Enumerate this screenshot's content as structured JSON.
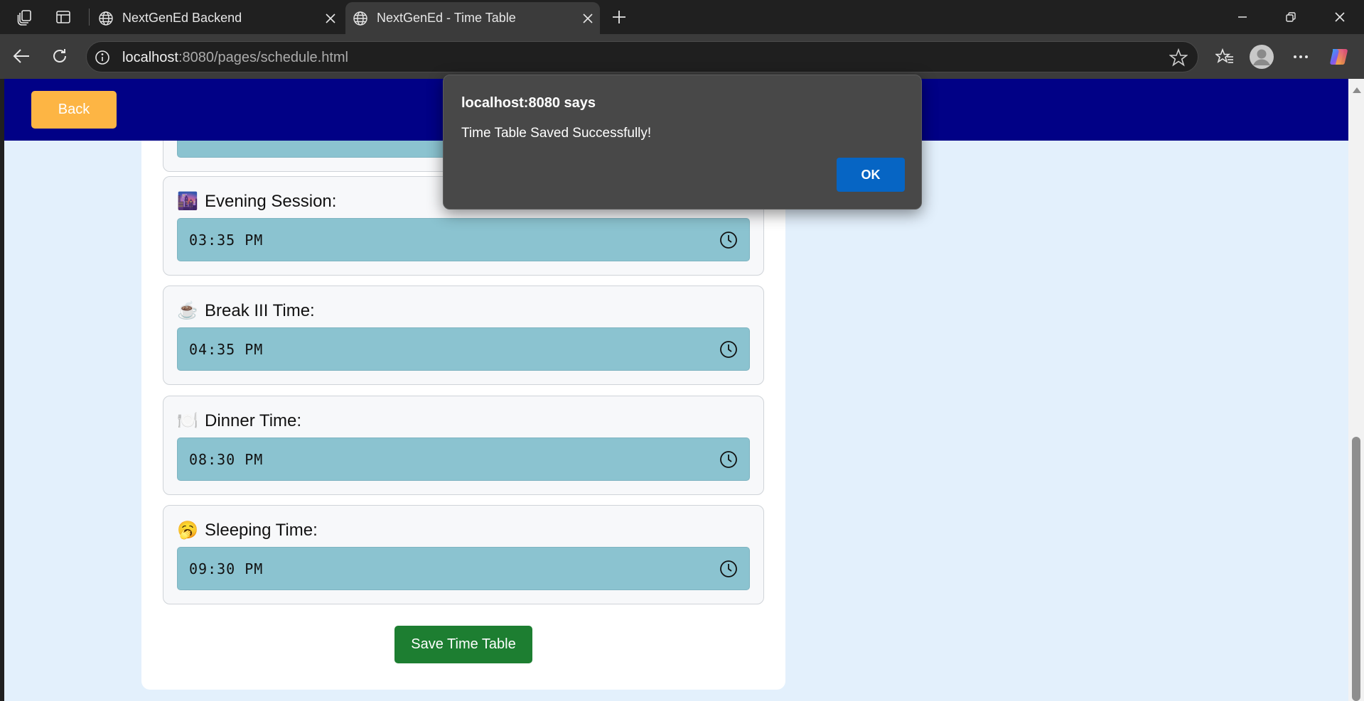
{
  "browser": {
    "tabs": [
      {
        "title": "NextGenEd Backend",
        "active": false
      },
      {
        "title": "NextGenEd - Time Table",
        "active": true
      }
    ],
    "url_host": "localhost",
    "url_rest": ":8080/pages/schedule.html"
  },
  "header": {
    "back_label": "Back"
  },
  "fields": [
    {
      "emoji": "🌆",
      "label": "Evening Session:",
      "time": "03:35 PM"
    },
    {
      "emoji": "☕",
      "label": "Break III Time:",
      "time": "04:35 PM"
    },
    {
      "emoji": "🍽️",
      "label": "Dinner Time:",
      "time": "08:30 PM"
    },
    {
      "emoji": "🥱",
      "label": "Sleeping Time:",
      "time": "09:30 PM"
    }
  ],
  "save_label": "Save Time Table",
  "dialog": {
    "title": "localhost:8080 says",
    "message": "Time Table Saved Successfully!",
    "ok_label": "OK"
  },
  "colors": {
    "header": "#010186",
    "back_button": "#fdb544",
    "save_button": "#1d7e31",
    "time_input": "#8bc3d0",
    "page_background": "#e3f0fc"
  }
}
